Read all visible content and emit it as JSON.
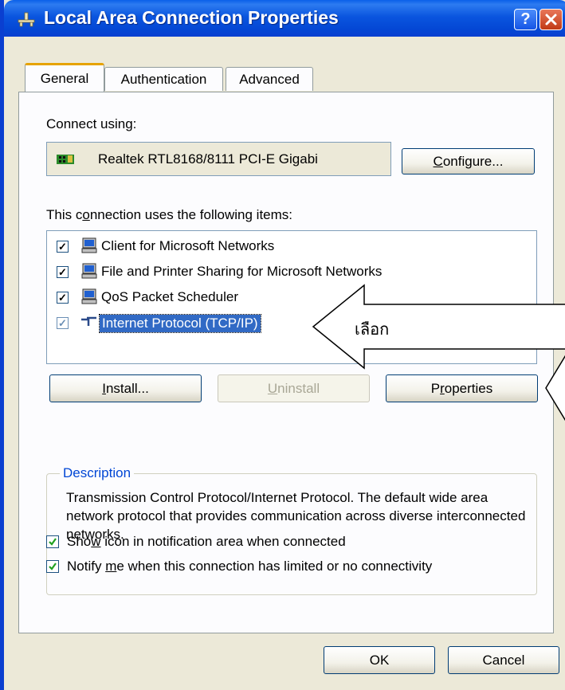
{
  "window": {
    "title": "Local Area Connection Properties"
  },
  "tabs": [
    {
      "label": "General",
      "active": true
    },
    {
      "label": "Authentication",
      "active": false
    },
    {
      "label": "Advanced",
      "active": false
    }
  ],
  "connect_using": {
    "label": "Connect using:",
    "adapter": "Realtek RTL8168/8111 PCI-E Gigabi",
    "configure_pre": "",
    "configure_u": "C",
    "configure_post": "onfigure..."
  },
  "items_section": {
    "label_pre": "This c",
    "label_u": "o",
    "label_post": "nnection uses the following items:",
    "items": [
      {
        "label": "Client for Microsoft Networks",
        "checked": true,
        "icon": "network-client-icon"
      },
      {
        "label": "File and Printer Sharing for Microsoft Networks",
        "checked": true,
        "icon": "file-printer-sharing-icon"
      },
      {
        "label": "QoS Packet Scheduler",
        "checked": true,
        "icon": "qos-scheduler-icon"
      },
      {
        "label": "Internet Protocol (TCP/IP)",
        "checked": true,
        "selected": true,
        "icon": "protocol-icon"
      }
    ]
  },
  "buttons": {
    "install_u": "I",
    "install_post": "nstall...",
    "uninstall_u": "U",
    "uninstall_post": "ninstall",
    "properties_pre": "P",
    "properties_u": "r",
    "properties_post": "operties",
    "ok": "OK",
    "cancel": "Cancel"
  },
  "description": {
    "title": "Description",
    "text": "Transmission Control Protocol/Internet Protocol. The default wide area network protocol that provides communication across diverse interconnected networks."
  },
  "options": [
    {
      "pre": "Sho",
      "u": "w",
      "post": " icon in notification area when connected",
      "checked": true
    },
    {
      "pre": "Notify ",
      "u": "m",
      "post": "e when this connection has limited or no connectivity",
      "checked": true
    }
  ],
  "annotation": {
    "text": "เลือก"
  },
  "colors": {
    "title_blue": "#0a55df",
    "selection": "#316ac5",
    "dialog_bg": "#ece9d8"
  }
}
